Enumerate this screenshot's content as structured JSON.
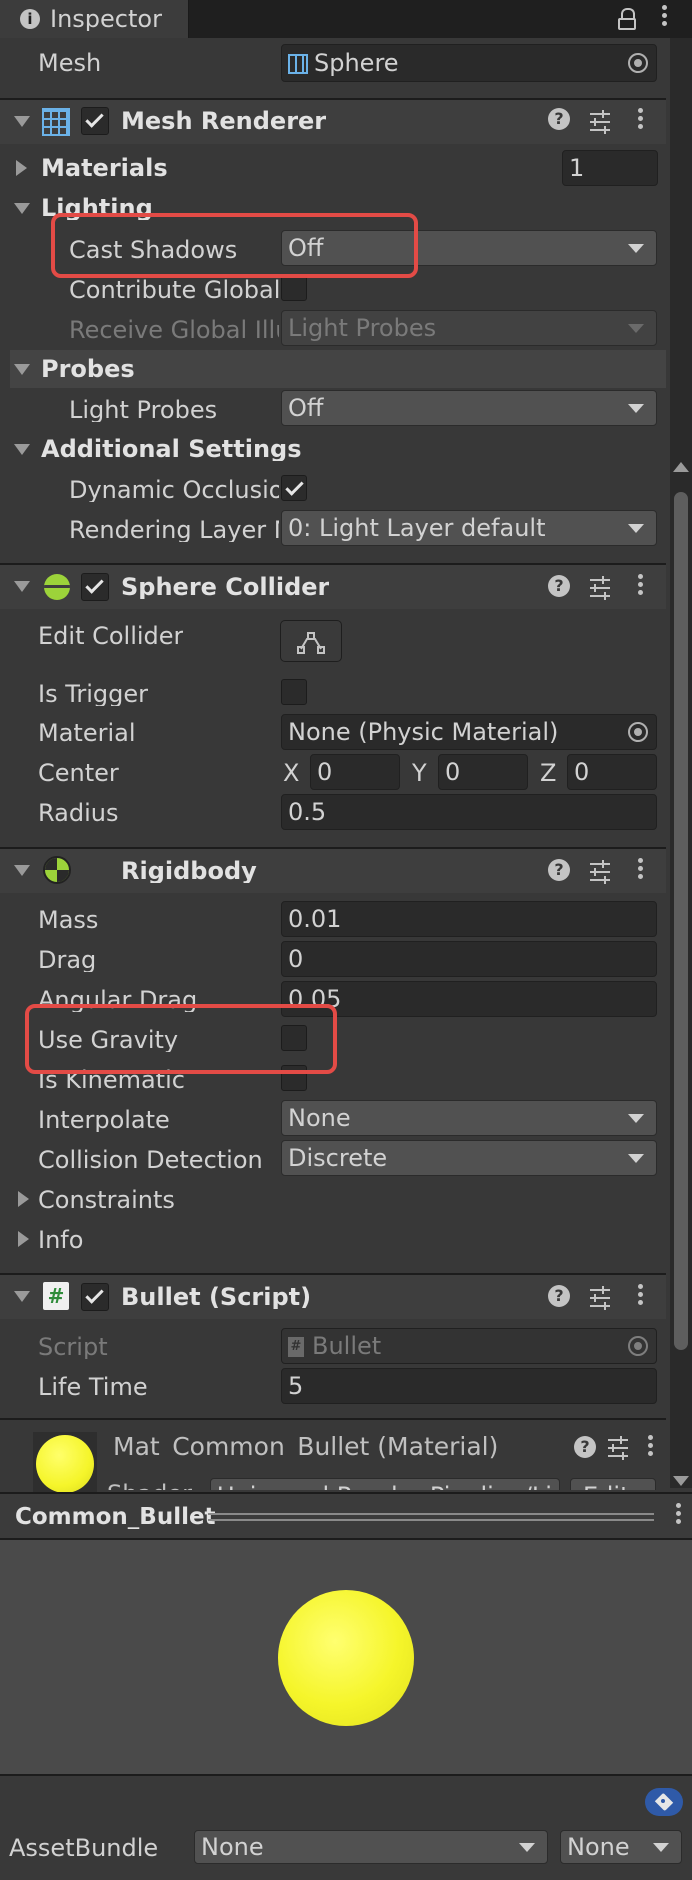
{
  "tab": {
    "title": "Inspector"
  },
  "mesh": {
    "label": "Mesh",
    "value": "Sphere"
  },
  "mesh_renderer": {
    "title": "Mesh Renderer",
    "materials": {
      "label": "Materials",
      "value": "1"
    },
    "lighting": {
      "label": "Lighting"
    },
    "cast_shadows": {
      "label": "Cast Shadows",
      "value": "Off"
    },
    "contribute_gi": {
      "label": "Contribute Global I"
    },
    "receive_gi": {
      "label": "Receive Global Illu",
      "value": "Light Probes"
    },
    "probes": {
      "label": "Probes"
    },
    "light_probes": {
      "label": "Light Probes",
      "value": "Off"
    },
    "additional_settings": {
      "label": "Additional Settings"
    },
    "dynamic_occlusion": {
      "label": "Dynamic Occlusio",
      "checked": true
    },
    "rendering_layer": {
      "label": "Rendering Layer M",
      "value": "0: Light Layer default"
    }
  },
  "sphere_collider": {
    "title": "Sphere Collider",
    "edit_collider": {
      "label": "Edit Collider"
    },
    "is_trigger": {
      "label": "Is Trigger",
      "checked": false
    },
    "material": {
      "label": "Material",
      "value": "None (Physic Material)"
    },
    "center": {
      "label": "Center",
      "x_label": "X",
      "x": "0",
      "y_label": "Y",
      "y": "0",
      "z_label": "Z",
      "z": "0"
    },
    "radius": {
      "label": "Radius",
      "value": "0.5"
    }
  },
  "rigidbody": {
    "title": "Rigidbody",
    "mass": {
      "label": "Mass",
      "value": "0.01"
    },
    "drag": {
      "label": "Drag",
      "value": "0"
    },
    "angular_drag": {
      "label": "Angular Drag",
      "value": "0.05"
    },
    "use_gravity": {
      "label": "Use Gravity",
      "checked": false
    },
    "is_kinematic": {
      "label": "Is Kinematic",
      "checked": false
    },
    "interpolate": {
      "label": "Interpolate",
      "value": "None"
    },
    "collision_detection": {
      "label": "Collision Detection",
      "value": "Discrete"
    },
    "constraints": {
      "label": "Constraints"
    },
    "info": {
      "label": "Info"
    }
  },
  "bullet_script": {
    "title": "Bullet (Script)",
    "script": {
      "label": "Script",
      "value": "Bullet"
    },
    "life_time": {
      "label": "Life Time",
      "value": "5"
    }
  },
  "material_header": {
    "title": "Mat_Common_Bullet (Material)",
    "shader_label": "Shader",
    "shader_value": "Universal Render Pipeline/Li",
    "edit_label": "Edit..."
  },
  "preview": {
    "title": "Common_Bullet"
  },
  "asset_bundle": {
    "label": "AssetBundle",
    "name_value": "None",
    "variant_value": "None"
  },
  "colors": {
    "accent_yellow": "#f5f52a",
    "highlight_red": "#e34b46",
    "collider_green": "#9cd33a"
  }
}
